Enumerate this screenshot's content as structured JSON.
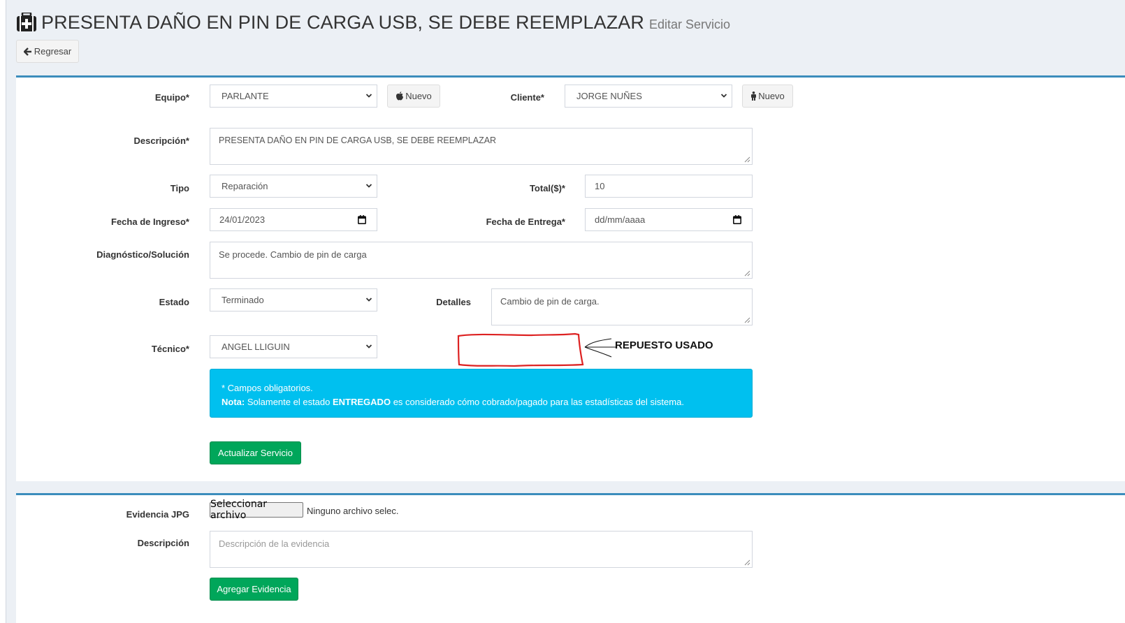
{
  "header": {
    "title": "PRESENTA DAÑO EN PIN DE CARGA USB, SE DEBE REEMPLAZAR",
    "subtitle": "Editar Servicio",
    "icon": "medkit-icon"
  },
  "back_button": {
    "label": "Regresar",
    "icon": "arrow-left-icon"
  },
  "form": {
    "equipo": {
      "label": "Equipo*",
      "value": "PARLANTE",
      "new_label": "Nuevo",
      "new_icon": "apple-icon"
    },
    "cliente": {
      "label": "Cliente*",
      "value": "JORGE NUÑES",
      "new_label": "Nuevo",
      "new_icon": "male-icon"
    },
    "descripcion": {
      "label": "Descripción*",
      "value": "PRESENTA DAÑO EN PIN DE CARGA USB, SE DEBE REEMPLAZAR"
    },
    "tipo": {
      "label": "Tipo",
      "value": "Reparación"
    },
    "total": {
      "label": "Total($)*",
      "value": "10"
    },
    "fecha_ingreso": {
      "label": "Fecha de Ingreso*",
      "value": "24/01/2023"
    },
    "fecha_entrega": {
      "label": "Fecha de Entrega*",
      "placeholder": "dd/mm/aaaa"
    },
    "diagnostico": {
      "label": "Diagnóstico/Solución",
      "value": "Se procede. Cambio de pin de carga"
    },
    "estado": {
      "label": "Estado",
      "value": "Terminado"
    },
    "detalles": {
      "label": "Detalles",
      "value": "Cambio de pin de carga."
    },
    "tecnico": {
      "label": "Técnico*",
      "value": "ANGEL LLIGUIN"
    },
    "annotation": {
      "text": "REPUESTO USADO",
      "color": "#dd2222"
    },
    "callout": {
      "line1": "* Campos obligatorios.",
      "nota_label": "Nota:",
      "nota_pre": "Solamente el estado",
      "nota_bold": "ENTREGADO",
      "nota_post": "es considerado cómo cobrado/pagado para las estadísticas del sistema."
    },
    "submit_label": "Actualizar Servicio"
  },
  "evidence": {
    "file_label": "Evidencia JPG",
    "file_button": "Seleccionar archivo",
    "file_status": "Ninguno archivo selec.",
    "desc_label": "Descripción",
    "desc_placeholder": "Descripción de la evidencia",
    "submit_label": "Agregar Evidencia"
  },
  "colors": {
    "primary_border": "#3c8dbc",
    "success": "#00a65a",
    "info": "#00c0ef",
    "background": "#ecf0f5"
  }
}
